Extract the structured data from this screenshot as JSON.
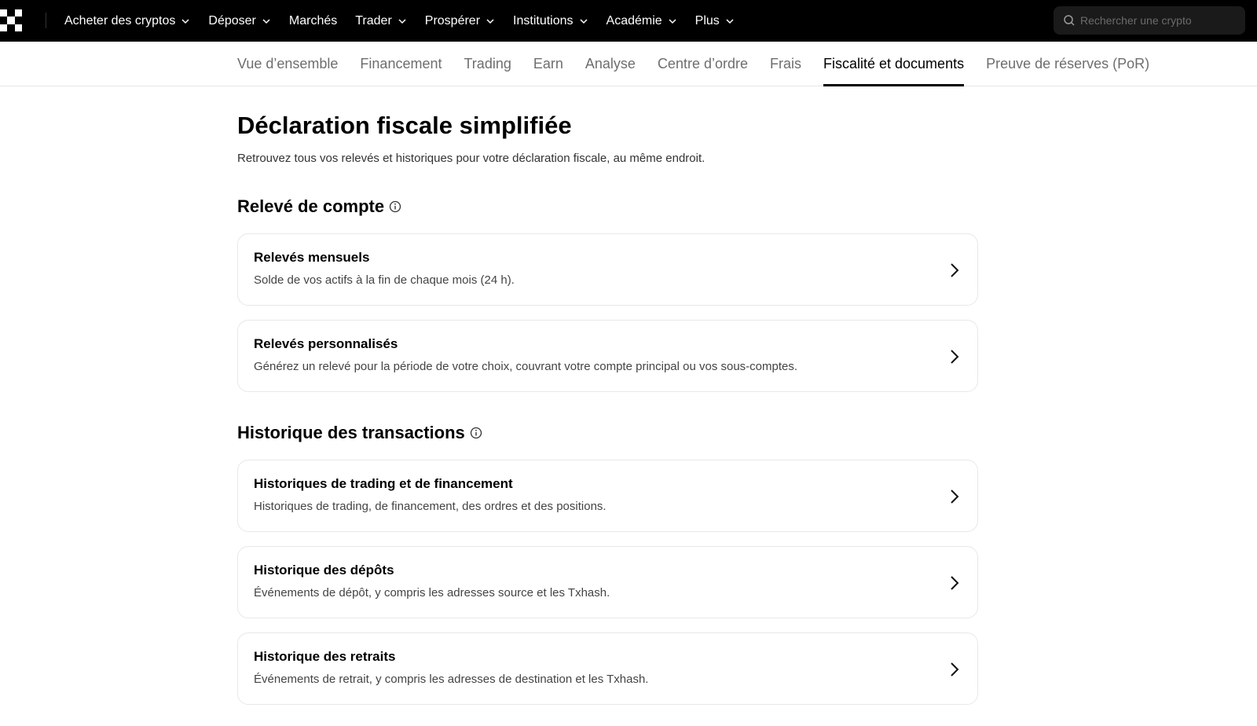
{
  "topbar": {
    "nav": [
      {
        "label": "Acheter des cryptos",
        "dropdown": true
      },
      {
        "label": "Déposer",
        "dropdown": true
      },
      {
        "label": "Marchés",
        "dropdown": false
      },
      {
        "label": "Trader",
        "dropdown": true
      },
      {
        "label": "Prospérer",
        "dropdown": true
      },
      {
        "label": "Institutions",
        "dropdown": true
      },
      {
        "label": "Académie",
        "dropdown": true
      },
      {
        "label": "Plus",
        "dropdown": true
      }
    ],
    "search": {
      "placeholder": "Rechercher une crypto",
      "icon": "search-icon"
    }
  },
  "subtabs": [
    {
      "label": "Vue d’ensemble",
      "active": false
    },
    {
      "label": "Financement",
      "active": false
    },
    {
      "label": "Trading",
      "active": false
    },
    {
      "label": "Earn",
      "active": false
    },
    {
      "label": "Analyse",
      "active": false
    },
    {
      "label": "Centre d’ordre",
      "active": false
    },
    {
      "label": "Frais",
      "active": false
    },
    {
      "label": "Fiscalité et documents",
      "active": true
    },
    {
      "label": "Preuve de réserves (PoR)",
      "active": false
    }
  ],
  "main": {
    "title": "Déclaration fiscale simplifiée",
    "subtitle": "Retrouvez tous vos relevés et historiques pour votre déclaration fiscale, au même endroit.",
    "sections": [
      {
        "title": "Relevé de compte",
        "cards": [
          {
            "title": "Relevés mensuels",
            "desc": "Solde de vos actifs à la fin de chaque mois (24 h)."
          },
          {
            "title": "Relevés personnalisés",
            "desc": "Générez un relevé pour la période de votre choix, couvrant votre compte principal ou vos sous-comptes."
          }
        ]
      },
      {
        "title": "Historique des transactions",
        "cards": [
          {
            "title": "Historiques de trading et de financement",
            "desc": "Historiques de trading, de financement, des ordres et des positions."
          },
          {
            "title": "Historique des dépôts",
            "desc": "Événements de dépôt, y compris les adresses source et les Txhash."
          },
          {
            "title": "Historique des retraits",
            "desc": "Événements de retrait, y compris les adresses de destination et les Txhash."
          }
        ]
      }
    ]
  },
  "colors": {
    "topbar_bg": "#000000",
    "active_tab": "#000000",
    "inactive_tab": "#6e6e6e"
  }
}
